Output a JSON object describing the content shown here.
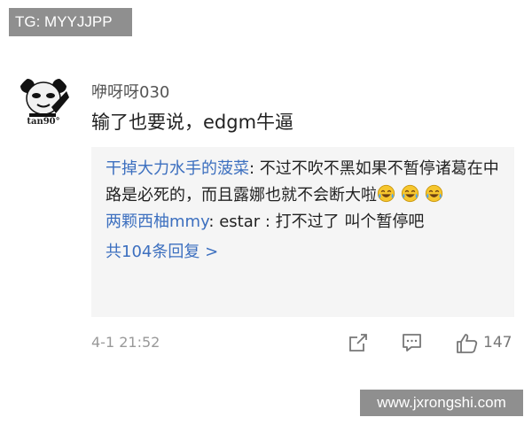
{
  "watermark_top": "TG: MYYJJPP",
  "watermark_bottom": "www.jxrongshi.com",
  "comment": {
    "avatar_caption": "tan90°",
    "username": "咿呀呀030",
    "content": "输了也要说，edgm牛逼",
    "replies": [
      {
        "author": "干掉大力水手的菠菜",
        "separator": ": ",
        "text": "不过不吹不黑如果不暂停诸葛在中路是必死的，而且露娜也就不会断大啦",
        "emoji": [
          "laugh-cry-emoji",
          "laugh-cry-emoji",
          "laugh-cry-emoji"
        ]
      },
      {
        "author": "两颗西柚mmy",
        "separator": ": ",
        "text": "estar : 打不过了 叫个暂停吧"
      }
    ],
    "more_replies": "共104条回复 >",
    "timestamp": "4-1 21:52",
    "actions": {
      "share_icon": "share-icon",
      "comment_icon": "comment-icon",
      "like_icon": "thumbs-up-icon",
      "like_count": "147"
    }
  },
  "colors": {
    "link_blue": "#3c6fbf",
    "reply_background": "#f5f5f5",
    "watermark_gray": "#8f8f8f",
    "meta_gray": "#999999"
  }
}
